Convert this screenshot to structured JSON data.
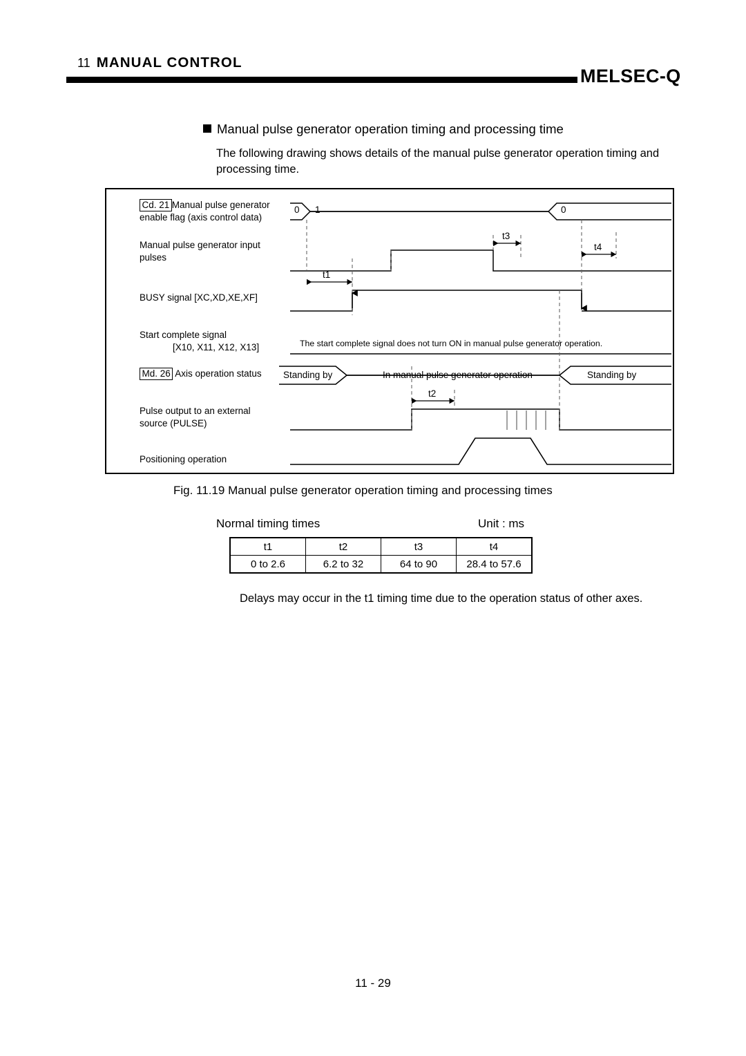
{
  "header": {
    "chapter_number": "11",
    "chapter_title": "MANUAL CONTROL",
    "brand": "MELSEC-Q"
  },
  "section": {
    "heading": "Manual pulse generator operation timing and processing time",
    "body": "The following drawing shows details of the manual pulse generator operation timing and processing time."
  },
  "diagram": {
    "signals": [
      {
        "ref": "Cd. 21",
        "label_line1": "Manual pulse generator",
        "label_line2": "enable flag (axis control data)",
        "values": [
          "0",
          "1",
          "0"
        ]
      },
      {
        "ref": "",
        "label_line1": "Manual pulse generator input",
        "label_line2": "pulses"
      },
      {
        "ref": "",
        "label_line1": "BUSY signal    [XC,XD,XE,XF]",
        "label_line2": ""
      },
      {
        "ref": "",
        "label_line1": "Start complete signal",
        "label_line2": "[X10, X11, X12, X13]"
      },
      {
        "ref": "Md. 26",
        "label_line1": "Axis operation status",
        "label_line2": "",
        "states": [
          "Standing by",
          "In manual pulse generator operation",
          "Standing by"
        ]
      },
      {
        "ref": "",
        "label_line1": "Pulse output to an external",
        "label_line2": "source (PULSE)"
      },
      {
        "ref": "",
        "label_line1": "Positioning operation",
        "label_line2": ""
      }
    ],
    "inline_note": "The start complete signal does not turn ON in manual pulse generator operation.",
    "time_markers": [
      "t1",
      "t2",
      "t3",
      "t4"
    ]
  },
  "figure": {
    "caption": "Fig. 11.19 Manual pulse generator operation timing and processing times"
  },
  "table": {
    "title": "Normal timing times",
    "unit": "Unit : ms",
    "headers": [
      "t1",
      "t2",
      "t3",
      "t4"
    ],
    "values": [
      "0 to 2.6",
      "6.2 to 32",
      "64 to 90",
      "28.4 to 57.6"
    ]
  },
  "footnote": "Delays may occur in the t1 timing time due to the operation status of other axes.",
  "page_number": "11 - 29"
}
